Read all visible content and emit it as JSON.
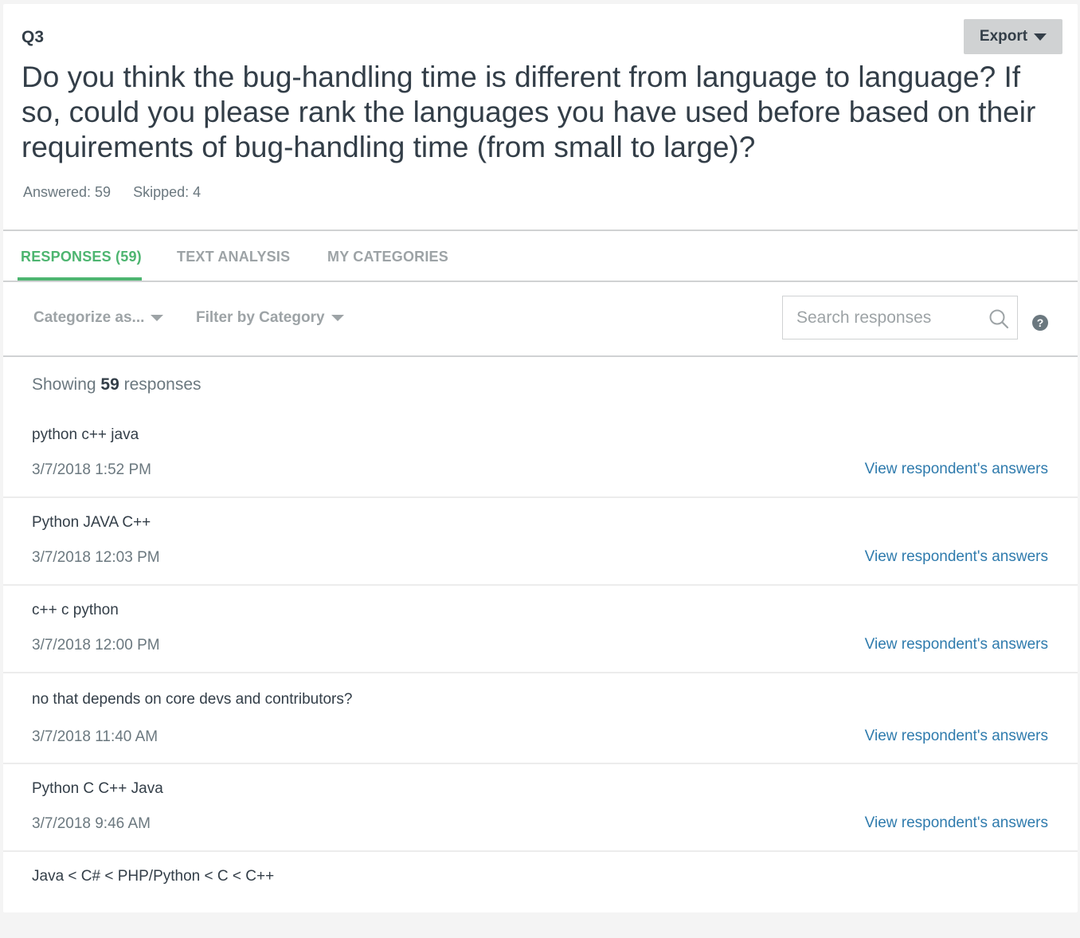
{
  "question": {
    "number": "Q3",
    "text": "Do you think the bug-handling time is different from language to language? If so, could you please rank the languages you have used before based on their requirements of bug-handling time (from small to large)?",
    "answered": "Answered: 59",
    "skipped": "Skipped: 4"
  },
  "export": {
    "label": "Export",
    "icon": "caret-down-icon"
  },
  "tabs": [
    {
      "label": "RESPONSES (59)",
      "active": true
    },
    {
      "label": "TEXT ANALYSIS",
      "active": false
    },
    {
      "label": "MY CATEGORIES",
      "active": false
    }
  ],
  "toolbar": {
    "categorize_label": "Categorize as...",
    "filter_label": "Filter by Category",
    "search_placeholder": "Search responses",
    "help_glyph": "?"
  },
  "summary": {
    "prefix": "Showing",
    "count": "59",
    "suffix": "responses"
  },
  "responses": [
    {
      "text": "python c++ java",
      "date": "3/7/2018 1:52 PM",
      "link": "View respondent's answers"
    },
    {
      "text": "Python JAVA C++",
      "date": "3/7/2018 12:03 PM",
      "link": "View respondent's answers"
    },
    {
      "text": "c++ c python",
      "date": "3/7/2018 12:00 PM",
      "link": "View respondent's answers"
    },
    {
      "text": "no that depends on core devs and contributors?",
      "date": "3/7/2018 11:40 AM",
      "link": "View respondent's answers"
    },
    {
      "text": "Python C C++ Java",
      "date": "3/7/2018 9:46 AM",
      "link": "View respondent's answers"
    },
    {
      "text": "Java < C# < PHP/Python < C < C++",
      "date": "",
      "link": ""
    }
  ],
  "colors": {
    "accent": "#4db570",
    "link": "#2f7bad",
    "muted": "#9da3a6"
  }
}
